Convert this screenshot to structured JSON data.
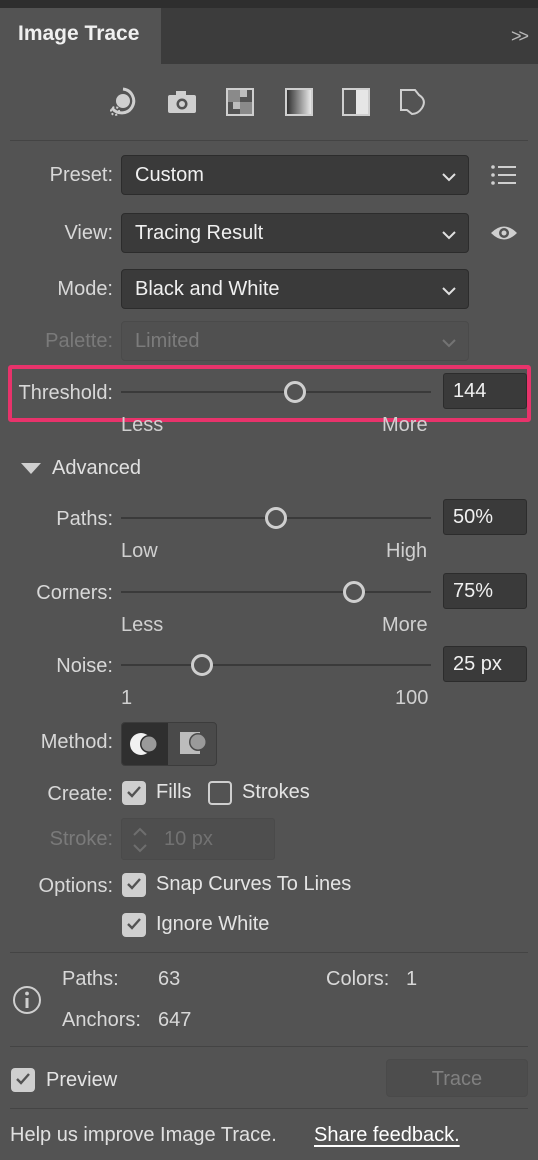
{
  "panel": {
    "tab_title": "Image Trace",
    "collapse_glyph": ">>"
  },
  "preset_icons": [
    "auto-color-icon",
    "high-color-icon",
    "low-color-icon",
    "grayscale-icon",
    "black-and-white-icon",
    "outline-icon"
  ],
  "preset": {
    "label": "Preset:",
    "value": "Custom"
  },
  "view": {
    "label": "View:",
    "value": "Tracing Result"
  },
  "mode": {
    "label": "Mode:",
    "value": "Black and White"
  },
  "palette": {
    "label": "Palette:",
    "value": "Limited"
  },
  "threshold": {
    "label": "Threshold:",
    "value": "144",
    "min_label": "Less",
    "max_label": "More",
    "level": 0.56
  },
  "advanced": {
    "label": "Advanced"
  },
  "paths": {
    "label": "Paths:",
    "value": "50%",
    "min_label": "Low",
    "max_label": "High",
    "level": 0.5
  },
  "corners": {
    "label": "Corners:",
    "value": "75%",
    "min_label": "Less",
    "max_label": "More",
    "level": 0.75
  },
  "noise": {
    "label": "Noise:",
    "value": "25 px",
    "min_label": "1",
    "max_label": "100",
    "level": 0.26
  },
  "method": {
    "label": "Method:"
  },
  "create": {
    "label": "Create:",
    "fills_label": "Fills",
    "strokes_label": "Strokes",
    "fills_checked": true,
    "strokes_checked": false
  },
  "stroke": {
    "label": "Stroke:",
    "value": "10 px"
  },
  "options": {
    "label": "Options:",
    "snap_label": "Snap Curves To Lines",
    "ignore_white_label": "Ignore White"
  },
  "stats": {
    "paths_label": "Paths:",
    "paths_value": "63",
    "colors_label": "Colors:",
    "colors_value": "1",
    "anchors_label": "Anchors:",
    "anchors_value": "647"
  },
  "preview": {
    "label": "Preview",
    "checked": true
  },
  "trace_button": "Trace",
  "footer": {
    "text": "Help us improve Image Trace.",
    "link": "Share feedback."
  },
  "colors": {
    "panel_bg": "#535353",
    "field_bg": "#3a3a3a",
    "highlight": "#e8336b"
  }
}
